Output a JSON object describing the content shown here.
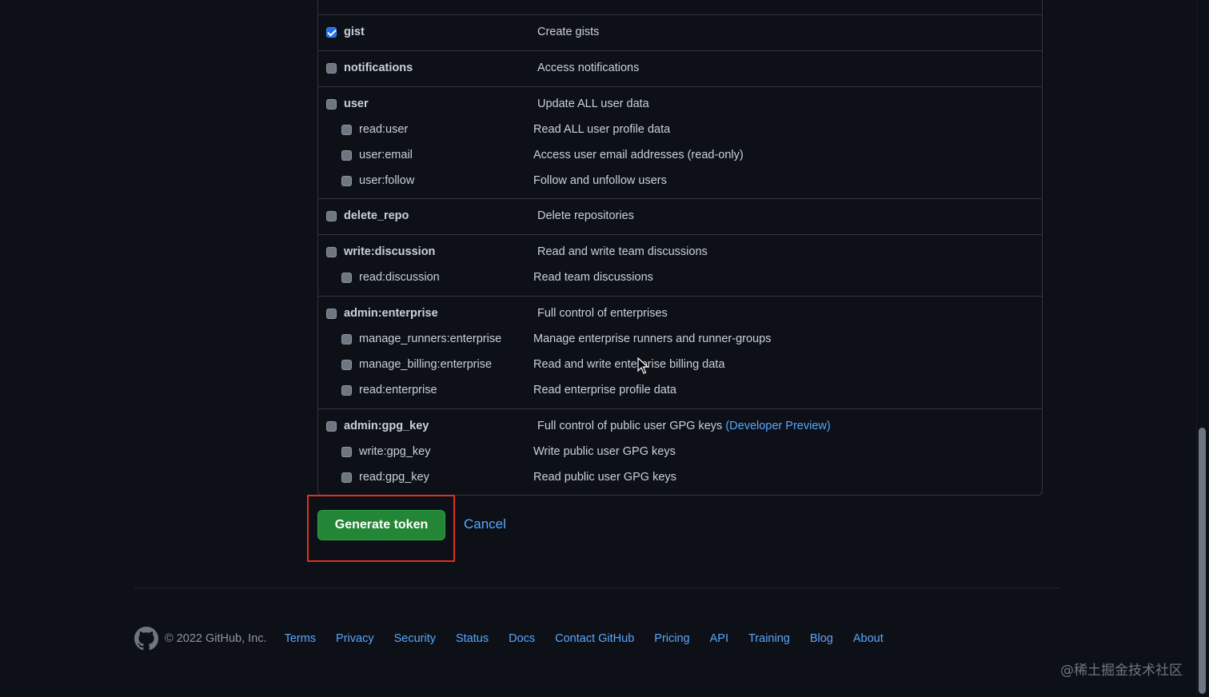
{
  "scope_groups": [
    {
      "parent": {
        "name": "gist",
        "description": "Create gists",
        "checked": true
      },
      "children": []
    },
    {
      "parent": {
        "name": "notifications",
        "description": "Access notifications",
        "checked": false
      },
      "children": []
    },
    {
      "parent": {
        "name": "user",
        "description": "Update ALL user data",
        "checked": false
      },
      "children": [
        {
          "name": "read:user",
          "description": "Read ALL user profile data",
          "checked": false
        },
        {
          "name": "user:email",
          "description": "Access user email addresses (read-only)",
          "checked": false
        },
        {
          "name": "user:follow",
          "description": "Follow and unfollow users",
          "checked": false
        }
      ]
    },
    {
      "parent": {
        "name": "delete_repo",
        "description": "Delete repositories",
        "checked": false
      },
      "children": []
    },
    {
      "parent": {
        "name": "write:discussion",
        "description": "Read and write team discussions",
        "checked": false
      },
      "children": [
        {
          "name": "read:discussion",
          "description": "Read team discussions",
          "checked": false
        }
      ]
    },
    {
      "parent": {
        "name": "admin:enterprise",
        "description": "Full control of enterprises",
        "checked": false
      },
      "children": [
        {
          "name": "manage_runners:enterprise",
          "description": "Manage enterprise runners and runner-groups",
          "checked": false
        },
        {
          "name": "manage_billing:enterprise",
          "description": "Read and write enterprise billing data",
          "checked": false
        },
        {
          "name": "read:enterprise",
          "description": "Read enterprise profile data",
          "checked": false
        }
      ]
    },
    {
      "parent": {
        "name": "admin:gpg_key",
        "description": "Full control of public user GPG keys",
        "link": "(Developer Preview)",
        "checked": false
      },
      "children": [
        {
          "name": "write:gpg_key",
          "description": "Write public user GPG keys",
          "checked": false
        },
        {
          "name": "read:gpg_key",
          "description": "Read public user GPG keys",
          "checked": false
        }
      ]
    }
  ],
  "actions": {
    "generate_label": "Generate token",
    "cancel_label": "Cancel"
  },
  "footer": {
    "copyright": "© 2022 GitHub, Inc.",
    "links": [
      "Terms",
      "Privacy",
      "Security",
      "Status",
      "Docs",
      "Contact GitHub",
      "Pricing",
      "API",
      "Training",
      "Blog",
      "About"
    ]
  },
  "watermark": "@稀土掘金技术社区",
  "colors": {
    "background": "#0d1117",
    "border": "#30363d",
    "link": "#58a6ff",
    "primary_button": "#238636",
    "checkbox_checked": "#1f6feb",
    "highlight": "#e0301e"
  }
}
